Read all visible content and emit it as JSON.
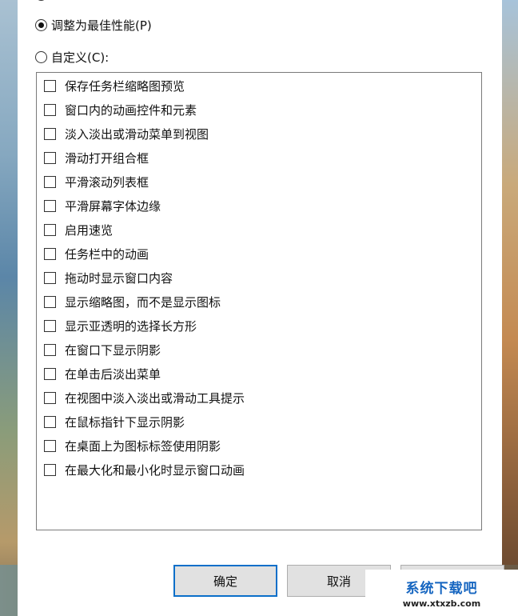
{
  "options": {
    "best_performance_label": "调整为最佳性能(P)",
    "custom_label": "自定义(C):"
  },
  "effects": [
    "保存任务栏缩略图预览",
    "窗口内的动画控件和元素",
    "淡入淡出或滑动菜单到视图",
    "滑动打开组合框",
    "平滑滚动列表框",
    "平滑屏幕字体边缘",
    "启用速览",
    "任务栏中的动画",
    "拖动时显示窗口内容",
    "显示缩略图，而不是显示图标",
    "显示亚透明的选择长方形",
    "在窗口下显示阴影",
    "在单击后淡出菜单",
    "在视图中淡入淡出或滑动工具提示",
    "在鼠标指针下显示阴影",
    "在桌面上为图标标签使用阴影",
    "在最大化和最小化时显示窗口动画"
  ],
  "buttons": {
    "ok": "确定",
    "cancel": "取消"
  },
  "watermark": {
    "title": "系统下载吧",
    "url": "www.xtxzb.com"
  },
  "colors": {
    "accent": "#0b6fc9",
    "watermark_blue": "#1565c0"
  }
}
